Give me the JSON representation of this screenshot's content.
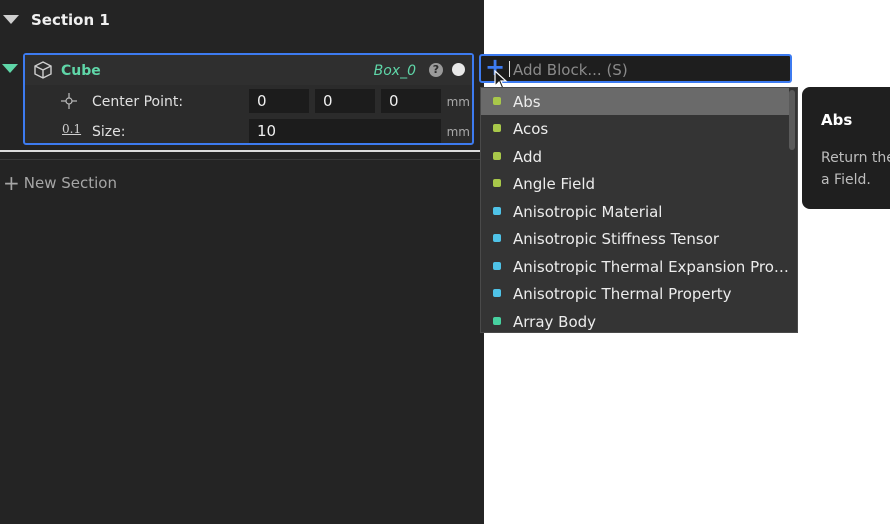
{
  "section": {
    "title": "Section 1"
  },
  "block": {
    "title": "Cube",
    "id_label": "Box_0",
    "help_symbol": "?",
    "params": [
      {
        "label": "Center Point:",
        "values": [
          "0",
          "0",
          "0"
        ],
        "unit": "mm",
        "icon": "center-point-icon"
      },
      {
        "label": "Size:",
        "values": [
          "10"
        ],
        "unit": "mm",
        "icon": "decimal-number-icon",
        "icon_text": "0.1"
      }
    ]
  },
  "new_section": {
    "label": "New Section"
  },
  "add_block": {
    "placeholder": "Add Block... (S)",
    "value": ""
  },
  "dropdown": {
    "items": [
      {
        "label": "Abs",
        "color": "#a8c84a",
        "selected": true
      },
      {
        "label": "Acos",
        "color": "#a8c84a"
      },
      {
        "label": "Add",
        "color": "#a8c84a"
      },
      {
        "label": "Angle Field",
        "color": "#a8c84a"
      },
      {
        "label": "Anisotropic Material",
        "color": "#4fc3e8"
      },
      {
        "label": "Anisotropic Stiffness Tensor",
        "color": "#4fc3e8"
      },
      {
        "label": "Anisotropic Thermal Expansion Property",
        "color": "#4fc3e8"
      },
      {
        "label": "Anisotropic Thermal Property",
        "color": "#4fc3e8"
      },
      {
        "label": "Array Body",
        "color": "#47d1a0"
      }
    ]
  },
  "tooltip": {
    "title": "Abs",
    "description": "Return the absolute value of a Field."
  },
  "colors": {
    "accent": "#3d7bf0",
    "block_title": "#5fd6a8",
    "panel_bg": "#242424"
  }
}
